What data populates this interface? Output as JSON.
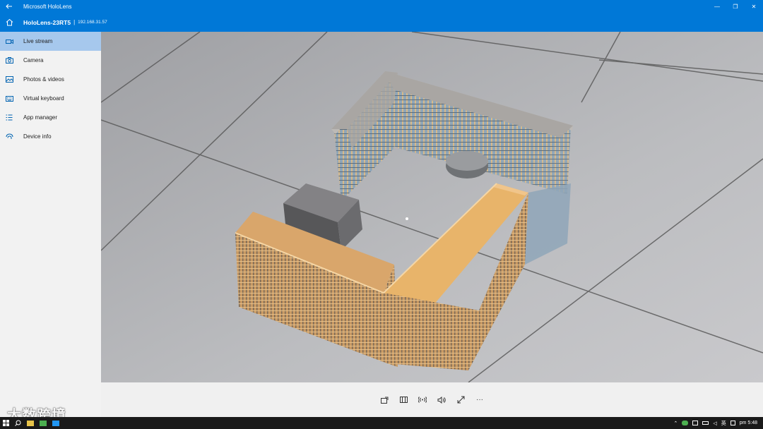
{
  "window": {
    "title": "Microsoft HoloLens",
    "minimize_glyph": "—",
    "restore_glyph": "❐",
    "close_glyph": "✕"
  },
  "header": {
    "device_name": "HoloLens-23RT5",
    "separator": "|",
    "device_ip": "192.168.31.57"
  },
  "sidebar": {
    "items": [
      {
        "label": "Live stream",
        "icon": "video-icon",
        "active": true
      },
      {
        "label": "Camera",
        "icon": "camera-icon",
        "active": false
      },
      {
        "label": "Photos & videos",
        "icon": "photos-icon",
        "active": false
      },
      {
        "label": "Virtual keyboard",
        "icon": "keyboard-icon",
        "active": false
      },
      {
        "label": "App manager",
        "icon": "list-icon",
        "active": false
      },
      {
        "label": "Device info",
        "icon": "info-icon",
        "active": false
      }
    ]
  },
  "toolbar": {
    "buttons": [
      "share-icon",
      "split-view-icon",
      "broadcast-icon",
      "volume-icon",
      "fullscreen-icon",
      "more-icon"
    ],
    "more_glyph": "···"
  },
  "watermark": {
    "text": "大数跨境"
  },
  "taskbar": {
    "language": "英",
    "time": "pm 5:48"
  },
  "colors": {
    "accent": "#0078d7",
    "nav_active": "#a6c8ed",
    "building_top": "#e8b46a",
    "building_roof_grey": "#a9a6a3"
  }
}
